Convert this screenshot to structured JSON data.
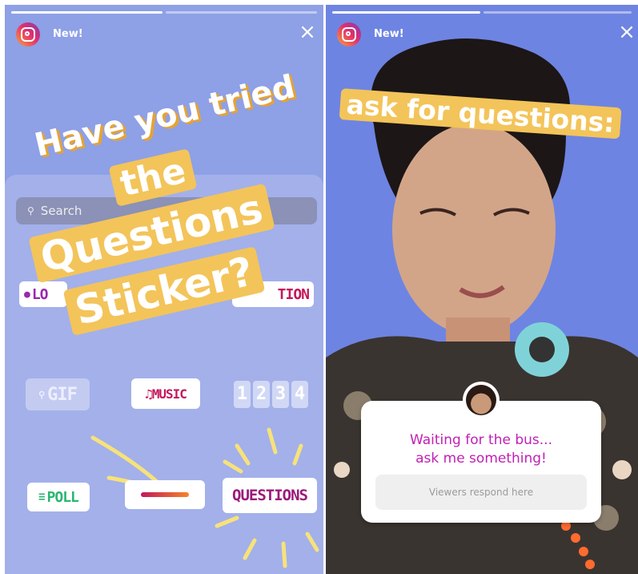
{
  "left": {
    "header_label": "New!",
    "close_glyph": "×",
    "headline": {
      "line1": "Have you tried",
      "line2": "the",
      "line3": "Questions",
      "line4": "Sticker?"
    },
    "search_placeholder": "Search",
    "stickers": {
      "location": "LO",
      "mention": "TION",
      "gif": "GIF",
      "music": "MUSIC",
      "countdown": [
        "1",
        "2",
        "3",
        "4"
      ],
      "poll": "POLL",
      "questions": "QUESTIONS"
    }
  },
  "right": {
    "header_label": "New!",
    "close_glyph": "×",
    "banner": "ask for questions:",
    "question_card": {
      "prompt_line1": "Waiting for the bus...",
      "prompt_line2": "ask me something!",
      "input_placeholder": "Viewers respond here"
    }
  },
  "icons": {
    "app": "instagram-icon",
    "close": "close-icon",
    "search": "search-icon",
    "location": "location-pin-icon",
    "music": "music-note-icon",
    "poll": "poll-icon"
  },
  "colors": {
    "sticker_yellow": "#f3c45a",
    "questions_purple": "#c020b5",
    "left_bg": "#8ea0e6",
    "right_bg": "#6e84e2"
  }
}
